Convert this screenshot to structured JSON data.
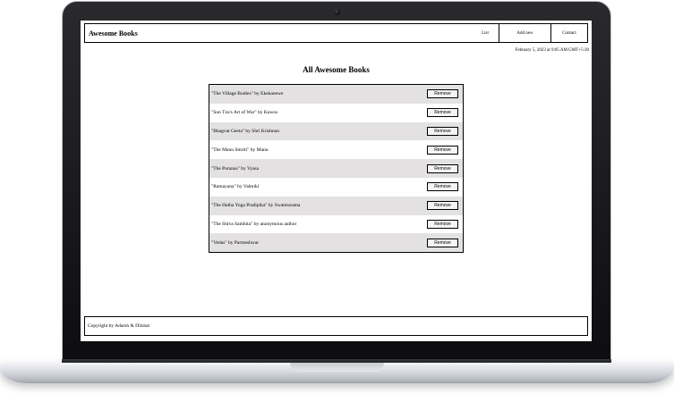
{
  "navbar": {
    "brand": "Awesome Books",
    "links": [
      "List",
      "Add new",
      "Contact"
    ]
  },
  "date_text": "February 5, 2023 at 9:05 AM GMT+5:30",
  "heading": "All Awesome Books",
  "books": [
    {
      "text": "\"The Village Bodies\" by Ekekanewe"
    },
    {
      "text": "\"Sun Tzu's Art of War\" by Kawos"
    },
    {
      "text": "\"Bhagvat Geeta\" by Shri Krishnan"
    },
    {
      "text": "\"The Manu Smriti\" by Manu"
    },
    {
      "text": "\"The Puranas\" by Vyasa"
    },
    {
      "text": "\"Ramayana\" by Valmiki"
    },
    {
      "text": "\"The Hatha Yoga Pradipika\" by Swatmarama"
    },
    {
      "text": "\"The Shiva Samhita\" by anonymous author"
    },
    {
      "text": "\"Vedas\" by Parmeshwar"
    }
  ],
  "remove_label": "Remove",
  "footer": "Copyright by Adarsh & Dilshat"
}
